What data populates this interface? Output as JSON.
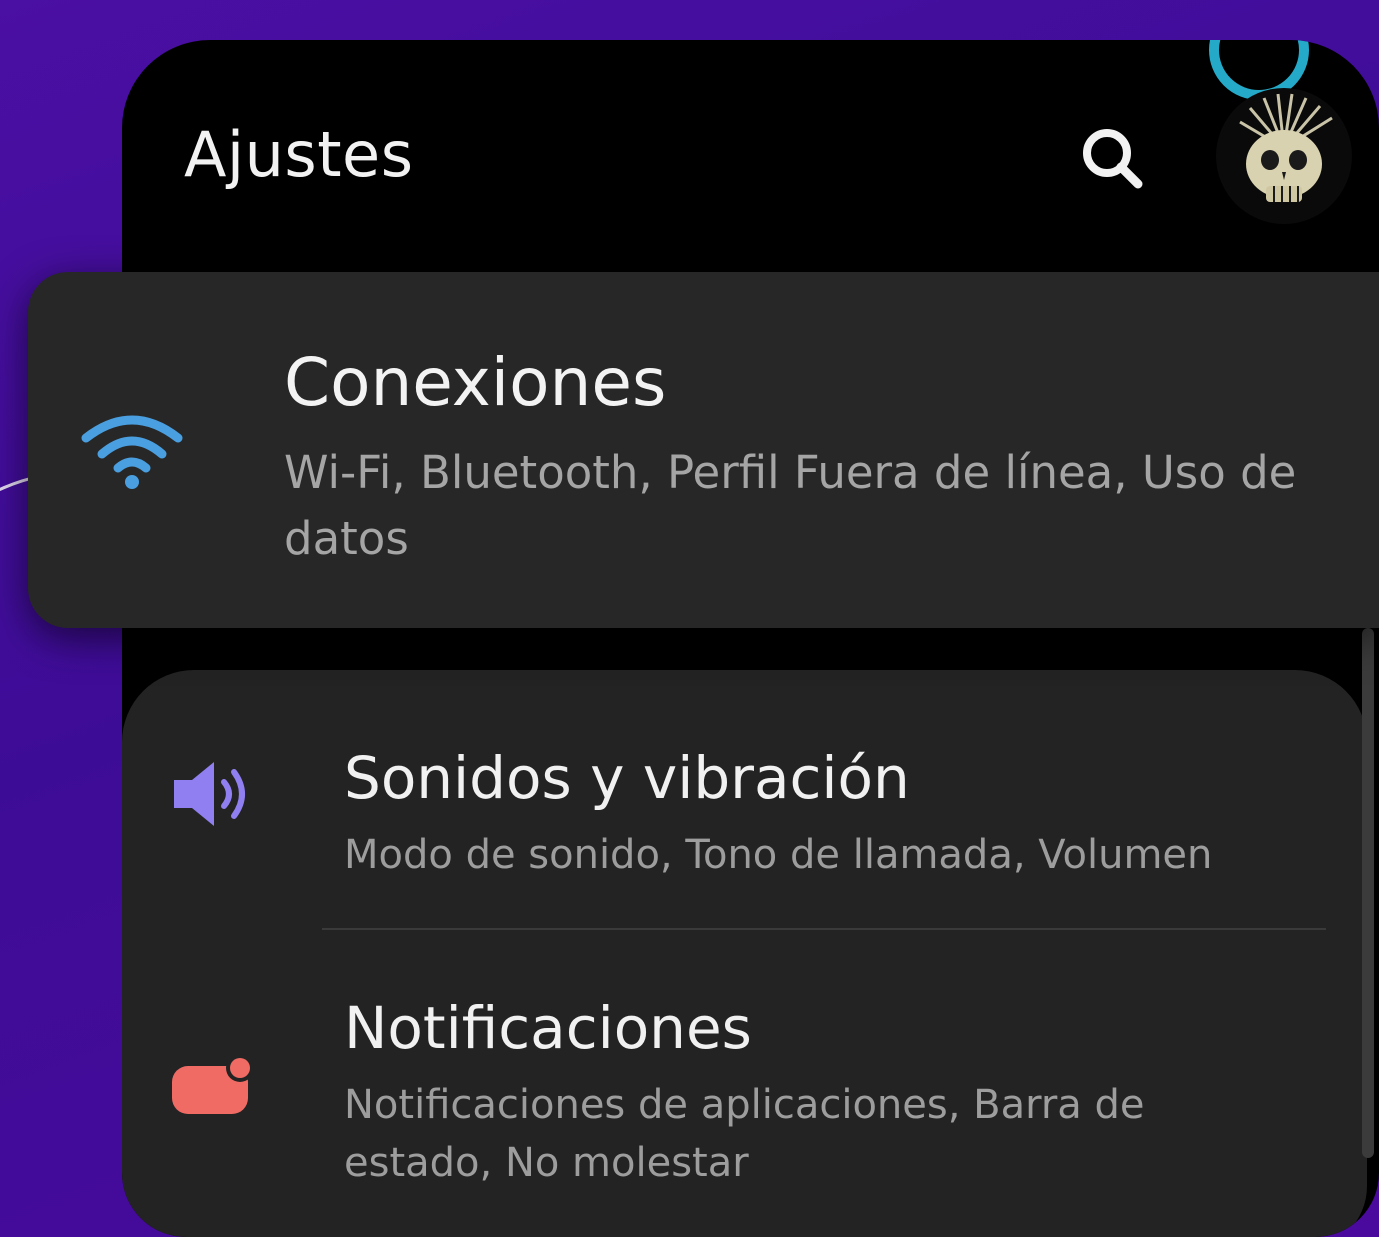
{
  "header": {
    "title": "Ajustes"
  },
  "icons": {
    "search": "search-icon",
    "avatar": "skull-avatar",
    "connections": "wifi-icon",
    "sounds": "speaker-icon",
    "notifications": "notification-icon"
  },
  "colors": {
    "background": "#4a0fa3",
    "wifi": "#4a9fe0",
    "sound": "#8f7ff0",
    "notifications": "#ef6b64"
  },
  "menu": [
    {
      "title": "Conexiones",
      "subtitle": "Wi-Fi, Bluetooth, Perfil Fuera de línea, Uso de datos"
    },
    {
      "title": "Sonidos y vibración",
      "subtitle": "Modo de sonido, Tono de llamada, Volumen"
    },
    {
      "title": "Notificaciones",
      "subtitle": "Notificaciones de aplicaciones, Barra de estado, No molestar"
    }
  ]
}
